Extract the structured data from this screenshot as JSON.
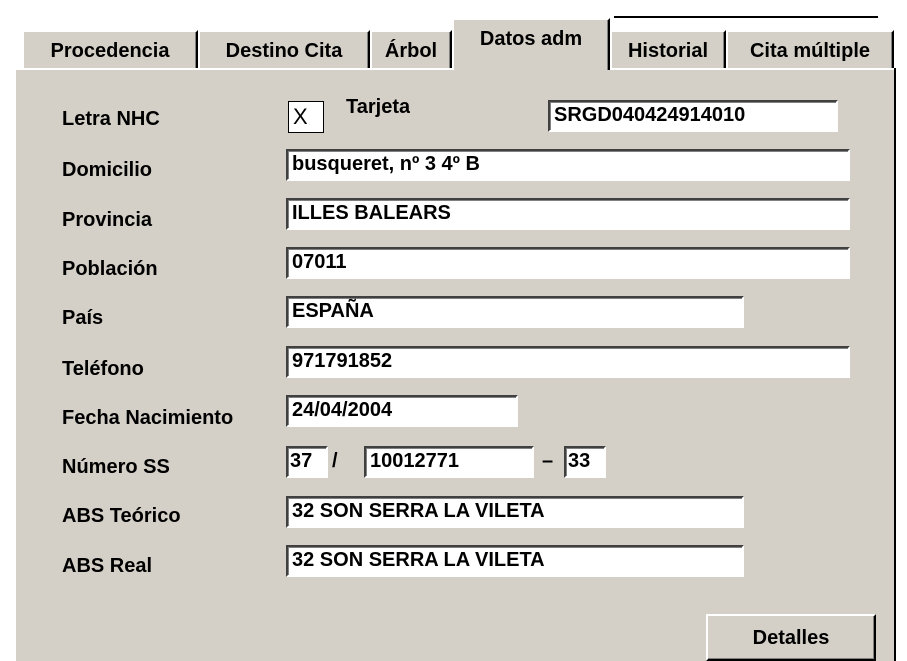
{
  "tabs": [
    {
      "label": "Procedencia",
      "active": false
    },
    {
      "label": "Destino Cita",
      "active": false
    },
    {
      "label": "Árbol",
      "active": false
    },
    {
      "label": "Datos adm",
      "active": true
    },
    {
      "label": "Historial",
      "active": false
    },
    {
      "label": "Cita múltiple",
      "active": false
    }
  ],
  "form": {
    "letra_nhc": {
      "label": "Letra NHC",
      "value": "X"
    },
    "tarjeta": {
      "label": "Tarjeta",
      "value": "SRGD040424914010"
    },
    "domicilio": {
      "label": "Domicilio",
      "value": "busqueret, nº 3 4º B"
    },
    "provincia": {
      "label": "Provincia",
      "value": "ILLES BALEARS"
    },
    "poblacion": {
      "label": "Población",
      "value": "07011"
    },
    "pais": {
      "label": "País",
      "value": "ESPAÑA"
    },
    "telefono": {
      "label": "Teléfono",
      "value": "971791852"
    },
    "fecha_nacimiento": {
      "label": "Fecha Nacimiento",
      "value": "24/04/2004"
    },
    "numero_ss": {
      "label": "Número SS",
      "part1": "37",
      "sep1": "/",
      "part2": "10012771",
      "sep2": "–",
      "part3": "33"
    },
    "abs_teorico": {
      "label": "ABS Teórico",
      "value": "32 SON SERRA LA VILETA"
    },
    "abs_real": {
      "label": "ABS Real",
      "value": "32 SON SERRA LA VILETA"
    }
  },
  "buttons": {
    "detalles": "Detalles"
  }
}
